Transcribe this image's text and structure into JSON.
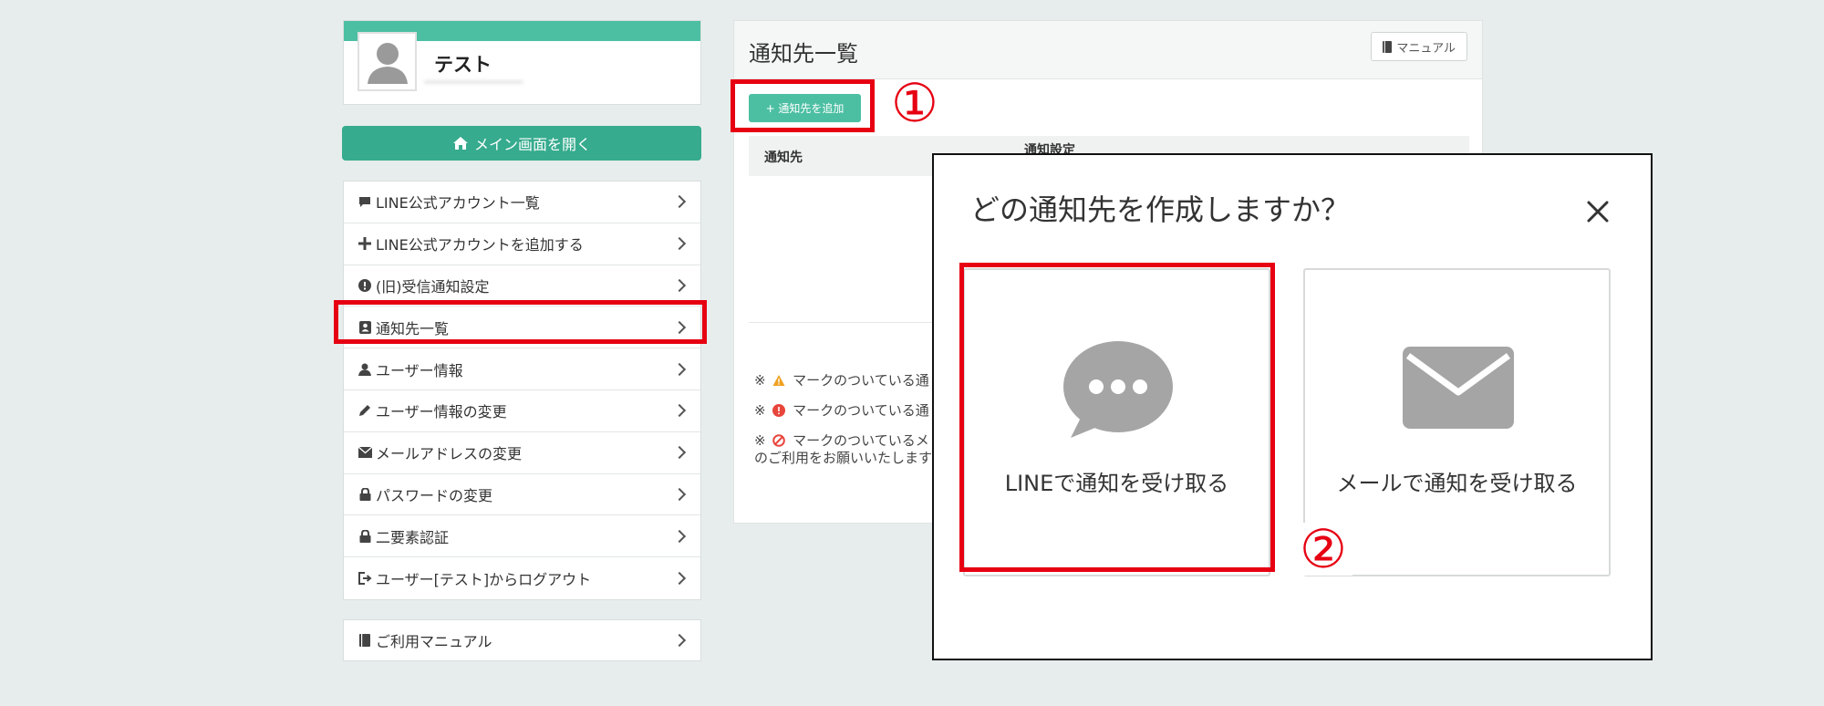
{
  "sidebar": {
    "profile_name": "テスト",
    "profile_sub": "━━━━━━━━━━━━━━━",
    "main_button": "メイン画面を開く",
    "menu": [
      {
        "label": "LINE公式アカウント一覧",
        "icon": "chat-icon"
      },
      {
        "label": "LINE公式アカウントを追加する",
        "icon": "plus-icon"
      },
      {
        "label": "(旧)受信通知設定",
        "icon": "alert-icon"
      },
      {
        "label": "通知先一覧",
        "icon": "contact-book-icon"
      },
      {
        "label": "ユーザー情報",
        "icon": "user-icon"
      },
      {
        "label": "ユーザー情報の変更",
        "icon": "pencil-icon"
      },
      {
        "label": "メールアドレスの変更",
        "icon": "envelope-icon"
      },
      {
        "label": "パスワードの変更",
        "icon": "lock-icon"
      },
      {
        "label": "二要素認証",
        "icon": "lock-icon"
      },
      {
        "label": "ユーザー[テスト]からログアウト",
        "icon": "logout-icon"
      }
    ],
    "manual": "ご利用マニュアル"
  },
  "panel": {
    "title": "通知先一覧",
    "manual_button": "マニュアル",
    "add_button": "+ 通知先を追加",
    "columns": [
      "通知先",
      "通知設定"
    ],
    "notes": [
      {
        "prefix": "※",
        "text": "マークのついている通",
        "mark": "warning-icon"
      },
      {
        "prefix": "※",
        "text": "マークのついている通",
        "mark": "error-icon"
      },
      {
        "prefix": "※",
        "text": "マークのついているメ",
        "mark": "blocked-icon"
      }
    ],
    "note_cont": "のご利用をお願いいたします"
  },
  "annotations": {
    "step1": "①",
    "step2": "②",
    "highlight_color": "#e60012"
  },
  "modal": {
    "title": "どの通知先を作成しますか？",
    "options": [
      {
        "label": "LINEで通知を受け取る",
        "icon": "chat-bubble-icon"
      },
      {
        "label": "メールで通知を受け取る",
        "icon": "mail-icon"
      }
    ]
  },
  "colors": {
    "accent": "#36ab8e",
    "accent_light": "#4cbfa3",
    "background": "#e7edec"
  }
}
